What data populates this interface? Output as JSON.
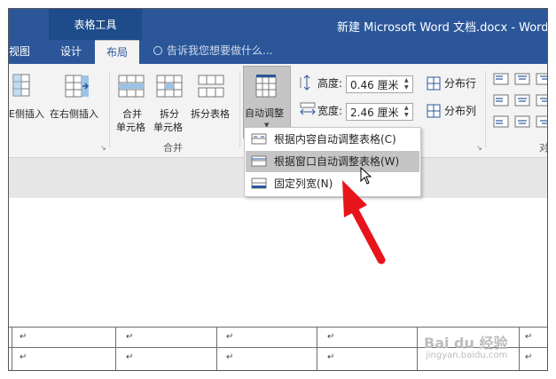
{
  "window": {
    "context_tab_title": "表格工具",
    "title": "新建 Microsoft Word 文档.docx - Word"
  },
  "tabs": {
    "view": "视图",
    "design": "设计",
    "layout": "布局"
  },
  "tell_me": {
    "placeholder": "告诉我您想要做什么..."
  },
  "ribbon": {
    "insert_left_partial": "E侧插入",
    "insert_right": "在右侧插入",
    "merge_cells_line1": "合并",
    "merge_cells_line2": "单元格",
    "split_cells_line1": "拆分",
    "split_cells_line2": "单元格",
    "split_table": "拆分表格",
    "merge_group_title": "合并",
    "autofit": "自动调整",
    "height_label": "高度:",
    "height_value": "0.46 厘米",
    "width_label": "宽度:",
    "width_value": "2.46 厘米",
    "distribute_rows": "分布行",
    "distribute_cols": "分布列",
    "group_launcher": "↘",
    "right_partial": "对"
  },
  "autofit_menu": {
    "items": [
      {
        "label": "根据内容自动调整表格(C)",
        "highlighted": false
      },
      {
        "label": "根据窗口自动调整表格(W)",
        "highlighted": true
      },
      {
        "label": "固定列宽(N)",
        "highlighted": false
      }
    ]
  },
  "table": {
    "cell_mark": "↵"
  },
  "watermark": {
    "brand": "Bai du 经验",
    "url": "jingyan.baidu.com"
  },
  "colors": {
    "title_bar": "#2b579a",
    "context_tab": "#1e4c8a",
    "ribbon_bg": "#f3f3f3",
    "menu_highlight": "#c5c5c5",
    "annotation_arrow": "#e8141b"
  }
}
